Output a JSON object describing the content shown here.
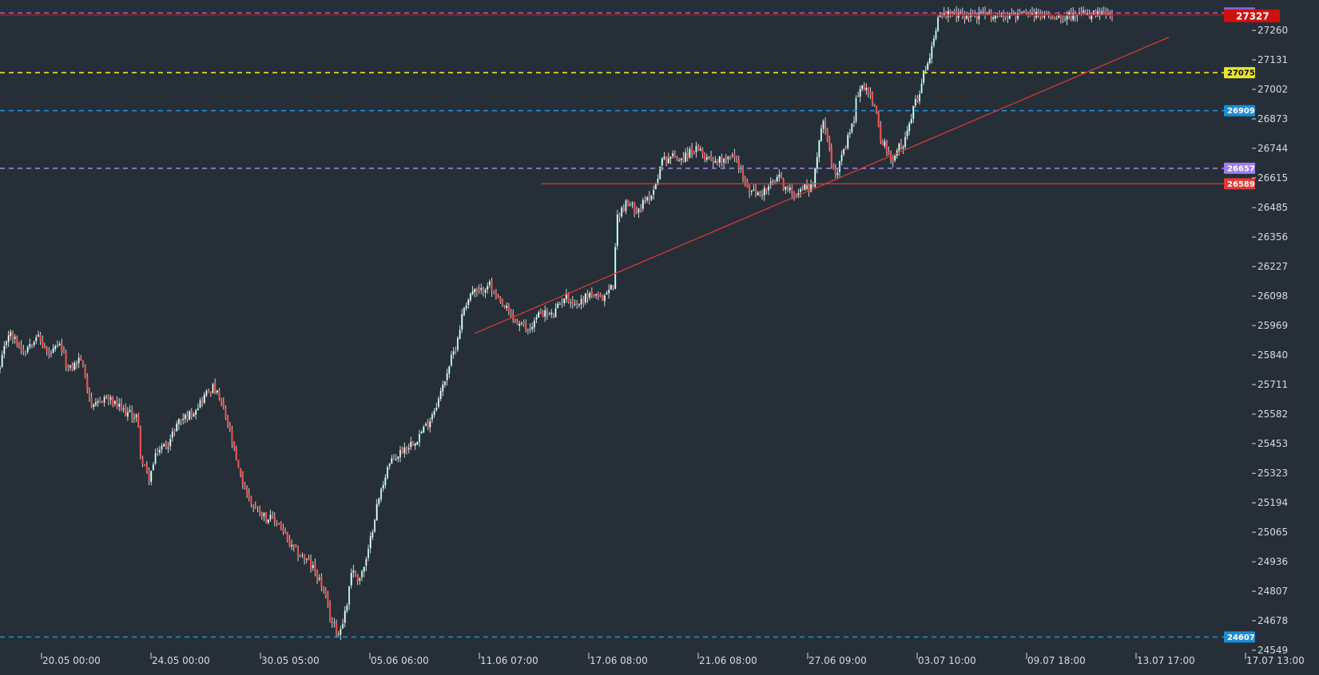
{
  "chart_data": {
    "type": "candlestick",
    "background": "#262f37",
    "title": "",
    "xlabel": "",
    "ylabel": "",
    "ylim": [
      24549,
      27330
    ],
    "colors": {
      "up": "#26a69a",
      "down": "#ef5350",
      "wick": "#e6e6e6",
      "axis_text": "#d7dbe0"
    },
    "y_ticks": [
      27260,
      27131,
      27002,
      26873,
      26744,
      26615,
      26485,
      26356,
      26227,
      26098,
      25969,
      25840,
      25711,
      25582,
      25453,
      25323,
      25194,
      25065,
      24936,
      24807,
      24678,
      24549
    ],
    "x_ticks": [
      "20.05 00:00",
      "24.05 00:00",
      "30.05 05:00",
      "05.06 06:00",
      "11.06 07:00",
      "17.06 08:00",
      "21.06 08:00",
      "27.06 09:00",
      "03.07 10:00",
      "09.07 18:00",
      "13.07 17:00",
      "17.07 13:00"
    ],
    "price_path": [
      [
        0.0,
        25780
      ],
      [
        0.01,
        25940
      ],
      [
        0.03,
        25860
      ],
      [
        0.045,
        25930
      ],
      [
        0.06,
        25840
      ],
      [
        0.075,
        25880
      ],
      [
        0.085,
        25770
      ],
      [
        0.1,
        25830
      ],
      [
        0.115,
        25600
      ],
      [
        0.13,
        25660
      ],
      [
        0.14,
        25630
      ],
      [
        0.155,
        25590
      ],
      [
        0.17,
        25570
      ],
      [
        0.175,
        25380
      ],
      [
        0.185,
        25300
      ],
      [
        0.195,
        25420
      ],
      [
        0.21,
        25460
      ],
      [
        0.22,
        25550
      ],
      [
        0.235,
        25580
      ],
      [
        0.245,
        25620
      ],
      [
        0.255,
        25670
      ],
      [
        0.265,
        25700
      ],
      [
        0.275,
        25620
      ],
      [
        0.285,
        25500
      ],
      [
        0.295,
        25340
      ],
      [
        0.31,
        25200
      ],
      [
        0.33,
        25130
      ],
      [
        0.345,
        25110
      ],
      [
        0.36,
        25000
      ],
      [
        0.375,
        24960
      ],
      [
        0.39,
        24900
      ],
      [
        0.4,
        24820
      ],
      [
        0.41,
        24680
      ],
      [
        0.42,
        24620
      ],
      [
        0.43,
        24750
      ],
      [
        0.435,
        24900
      ],
      [
        0.445,
        24860
      ],
      [
        0.455,
        24950
      ],
      [
        0.465,
        25150
      ],
      [
        0.48,
        25350
      ],
      [
        0.5,
        25430
      ],
      [
        0.515,
        25470
      ],
      [
        0.53,
        25540
      ],
      [
        0.545,
        25660
      ],
      [
        0.555,
        25780
      ],
      [
        0.565,
        25880
      ],
      [
        0.575,
        26050
      ],
      [
        0.585,
        26120
      ],
      [
        0.595,
        26110
      ],
      [
        0.605,
        26160
      ],
      [
        0.615,
        26080
      ],
      [
        0.625,
        26050
      ],
      [
        0.64,
        25980
      ],
      [
        0.655,
        25950
      ],
      [
        0.67,
        26030
      ],
      [
        0.685,
        26010
      ],
      [
        0.7,
        26100
      ],
      [
        0.715,
        26060
      ],
      [
        0.73,
        26110
      ],
      [
        0.745,
        26080
      ],
      [
        0.76,
        26150
      ],
      [
        0.765,
        26450
      ],
      [
        0.775,
        26500
      ],
      [
        0.79,
        26480
      ],
      [
        0.8,
        26510
      ],
      [
        0.81,
        26560
      ],
      [
        0.82,
        26690
      ],
      [
        0.83,
        26710
      ],
      [
        0.845,
        26700
      ],
      [
        0.86,
        26740
      ],
      [
        0.875,
        26710
      ],
      [
        0.89,
        26690
      ],
      [
        0.905,
        26720
      ],
      [
        0.915,
        26680
      ],
      [
        0.925,
        26570
      ],
      [
        0.94,
        26540
      ],
      [
        0.955,
        26580
      ],
      [
        0.965,
        26620
      ],
      [
        0.975,
        26560
      ],
      [
        0.985,
        26550
      ],
      [
        1.0,
        26580
      ]
    ],
    "price_path_2": [
      [
        0.0,
        26580
      ],
      [
        0.02,
        26570
      ],
      [
        0.035,
        26740
      ],
      [
        0.05,
        26860
      ],
      [
        0.065,
        26820
      ],
      [
        0.08,
        26700
      ],
      [
        0.095,
        26640
      ],
      [
        0.11,
        26680
      ],
      [
        0.125,
        26740
      ],
      [
        0.14,
        26810
      ],
      [
        0.155,
        26880
      ],
      [
        0.165,
        26990
      ],
      [
        0.18,
        27000
      ],
      [
        0.195,
        27020
      ],
      [
        0.21,
        26980
      ],
      [
        0.225,
        26900
      ],
      [
        0.24,
        26800
      ],
      [
        0.255,
        26760
      ],
      [
        0.27,
        26700
      ],
      [
        0.285,
        26680
      ],
      [
        0.3,
        26760
      ],
      [
        0.315,
        26740
      ],
      [
        0.33,
        26850
      ],
      [
        0.345,
        26900
      ],
      [
        0.36,
        26960
      ],
      [
        0.375,
        27020
      ],
      [
        0.39,
        27110
      ],
      [
        0.405,
        27160
      ],
      [
        0.42,
        27250
      ],
      [
        0.43,
        27327
      ]
    ],
    "levels": [
      {
        "value": 27336,
        "color": "#8e63d8",
        "label": "27336",
        "style": "dashed",
        "start": 0.0
      },
      {
        "value": 27327,
        "color": "#cc1111",
        "label": "27327",
        "style": "solid",
        "start": 0.0
      },
      {
        "value": 27075,
        "color": "#e8e531",
        "label": "27075",
        "style": "dashed",
        "start": 0.0
      },
      {
        "value": 26909,
        "color": "#1e8cd8",
        "label": "26909",
        "style": "dashed",
        "start": 0.0
      },
      {
        "value": 26657,
        "color": "#a07cf0",
        "label": "26657",
        "style": "dashed",
        "start": 0.0
      },
      {
        "value": 26589,
        "color": "#e53935",
        "label": "26589",
        "style": "solid",
        "start": 0.44
      },
      {
        "value": 24607,
        "color": "#1e8cd8",
        "label": "24607",
        "style": "dashed",
        "start": 0.0
      }
    ],
    "trendline": {
      "color": "#e53935",
      "from": {
        "x_fraction": 0.386,
        "value": 25935
      },
      "to": {
        "x_fraction": 0.95,
        "value": 27230
      }
    },
    "current_price": 27327,
    "grid": false,
    "legend": "none"
  }
}
